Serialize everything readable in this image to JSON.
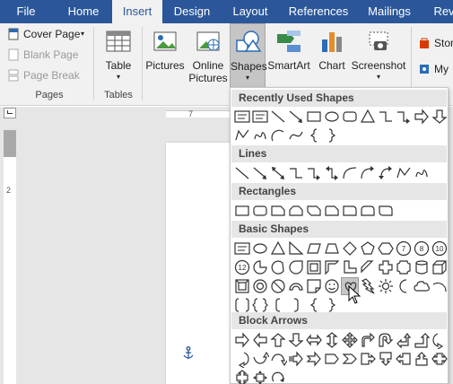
{
  "tabs": [
    {
      "label": "File",
      "active": false
    },
    {
      "label": "Home",
      "active": false
    },
    {
      "label": "Insert",
      "active": true
    },
    {
      "label": "Design",
      "active": false
    },
    {
      "label": "Layout",
      "active": false
    },
    {
      "label": "References",
      "active": false
    },
    {
      "label": "Mailings",
      "active": false
    },
    {
      "label": "Rev",
      "active": false
    }
  ],
  "ribbon": {
    "pages": {
      "cover_page": "Cover Page",
      "blank_page": "Blank Page",
      "page_break": "Page Break",
      "group_label": "Pages"
    },
    "tables": {
      "table": "Table",
      "group_label": "Tables"
    },
    "illustrations": {
      "pictures": "Pictures",
      "online_pictures_1": "Online",
      "online_pictures_2": "Pictures",
      "shapes": "Shapes",
      "smartart": "SmartArt",
      "chart": "Chart",
      "screenshot": "Screenshot"
    },
    "addins": {
      "store": "Stor",
      "my_addins": "My"
    }
  },
  "ruler": {
    "h_number": "7",
    "v_number": "2"
  },
  "gallery": {
    "sections": [
      {
        "title": "Recently Used Shapes"
      },
      {
        "title": "Lines"
      },
      {
        "title": "Rectangles"
      },
      {
        "title": "Basic Shapes"
      },
      {
        "title": "Block Arrows"
      }
    ],
    "hovered_shape": "heart",
    "basic_shape_numbers": [
      "7",
      "8",
      "10",
      "12"
    ]
  },
  "colors": {
    "accent": "#2b579a",
    "ribbon_bg": "#f1f1f1",
    "section_header": "#e6e6e6",
    "store_icon": "#d83b01",
    "chart_blue": "#2b6cb5",
    "chart_orange": "#e58c2b"
  }
}
